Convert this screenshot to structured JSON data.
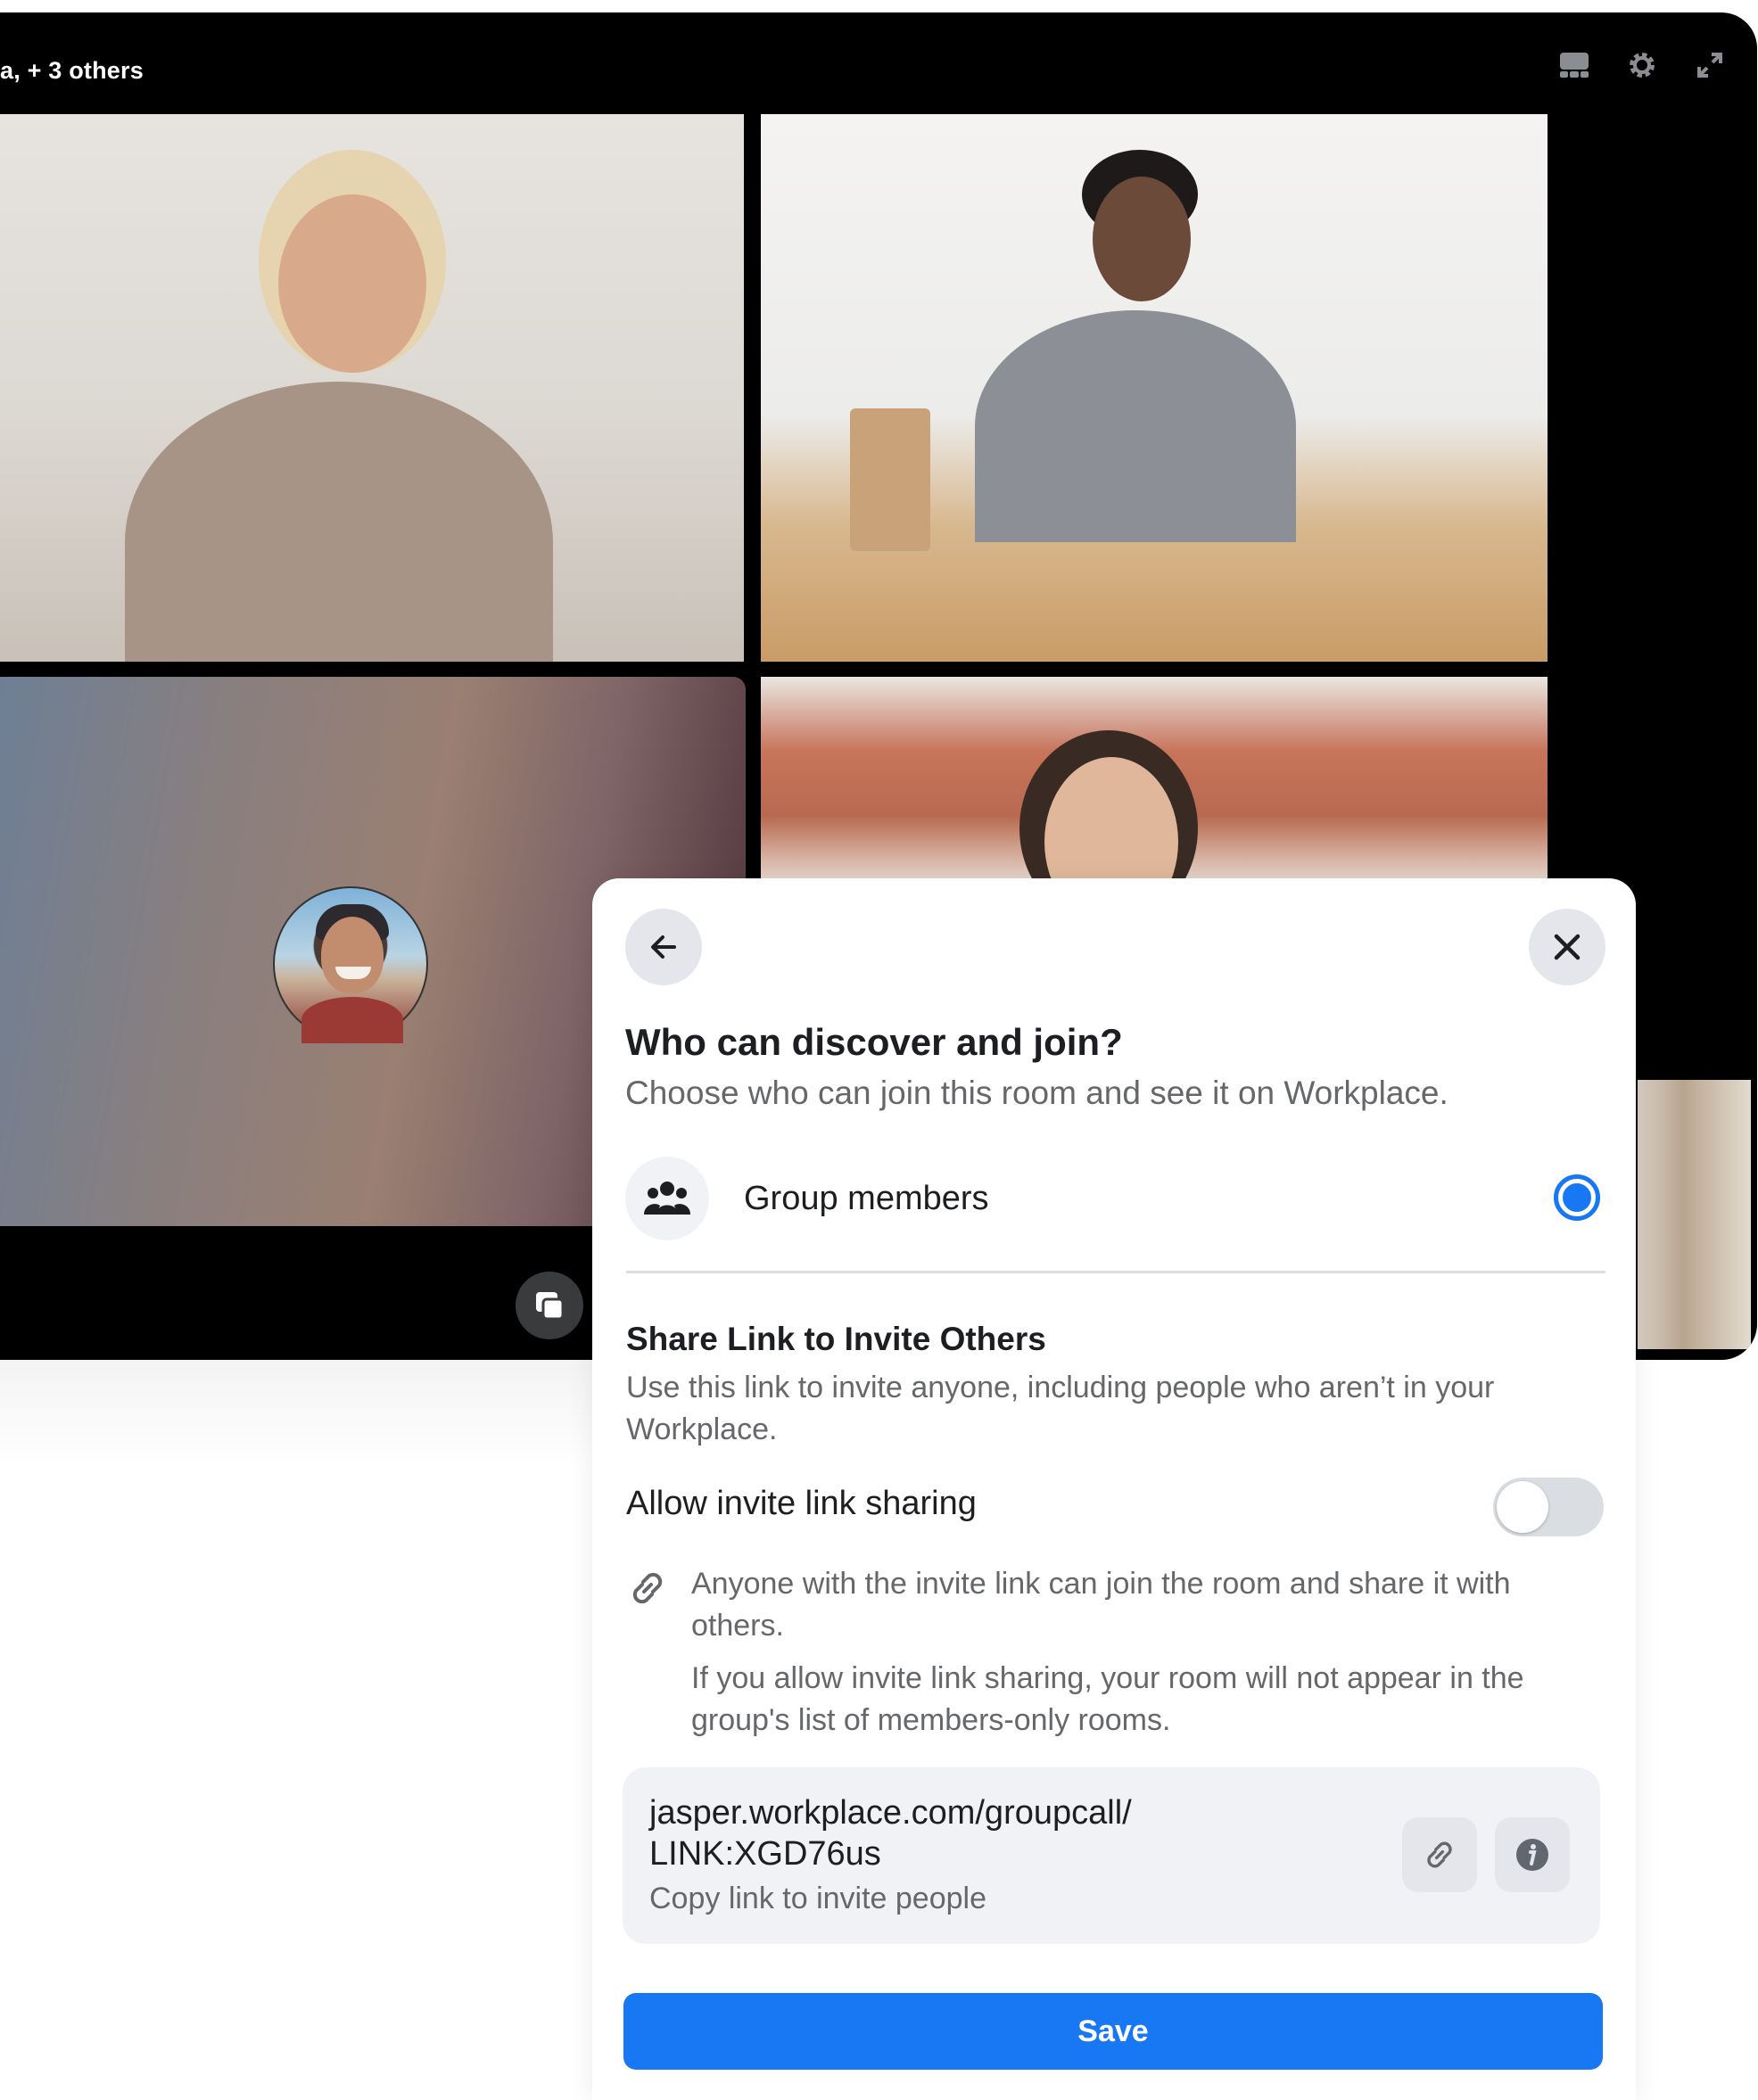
{
  "call": {
    "title": "a, + 3 others",
    "icons": [
      "layout-icon",
      "gear-icon",
      "expand-icon",
      "pip-icon"
    ]
  },
  "dialog": {
    "heading": "Who can discover and join?",
    "subheading": "Choose who can join this room and see it on Workplace.",
    "option": {
      "label": "Group members",
      "icon": "group-icon",
      "selected": true
    },
    "share": {
      "title": "Share Link to Invite Others",
      "description": "Use this link to invite anyone, including people who aren’t in your Workplace."
    },
    "toggle": {
      "label": "Allow invite link sharing",
      "on": false
    },
    "info": {
      "line1": "Anyone with the invite link can join the room and share it with others.",
      "line2": "If you allow invite link sharing, your room will not appear in the group's list of members-only rooms."
    },
    "link": {
      "url": "jasper.workplace.com/groupcall/ LINK:XGD76us",
      "hint": "Copy link to invite people"
    },
    "save_label": "Save"
  },
  "colors": {
    "accent": "#1877f2",
    "background": "#000000",
    "muted_text": "#65676b"
  }
}
